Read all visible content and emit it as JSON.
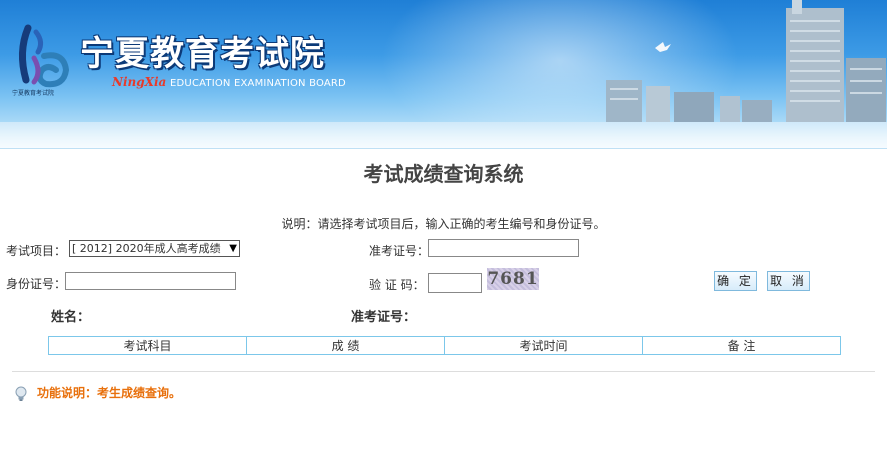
{
  "header": {
    "title_cn": "宁夏教育考试院",
    "title_pinyin": "NingXia",
    "title_en": "EDUCATION EXAMINATION BOARD",
    "logo_caption": "宁夏教育考试院"
  },
  "main": {
    "page_title": "考试成绩查询系统",
    "instruction": "说明：请选择考试项目后，输入正确的考生编号和身份证号。",
    "form": {
      "exam_item_label": "考试项目：",
      "exam_item_value": "[ 2012] 2020年成人高考成绩",
      "admission_label": "准考证号：",
      "admission_value": "",
      "id_label": "身份证号：",
      "id_value": "",
      "captcha_label": "验 证 码：",
      "captcha_value": "",
      "captcha_image_text": "7681",
      "confirm_label": "确 定",
      "cancel_label": "取 消"
    },
    "result": {
      "name_label": "姓名：",
      "admission_label": "准考证号：",
      "columns": [
        "考试科目",
        "成 绩",
        "考试时间",
        "备 注"
      ]
    },
    "function_note": "功能说明：考生成绩查询。"
  },
  "colors": {
    "banner_blue": "#2b8ae0",
    "note_orange": "#e8700c",
    "table_border": "#7cc7ea"
  }
}
